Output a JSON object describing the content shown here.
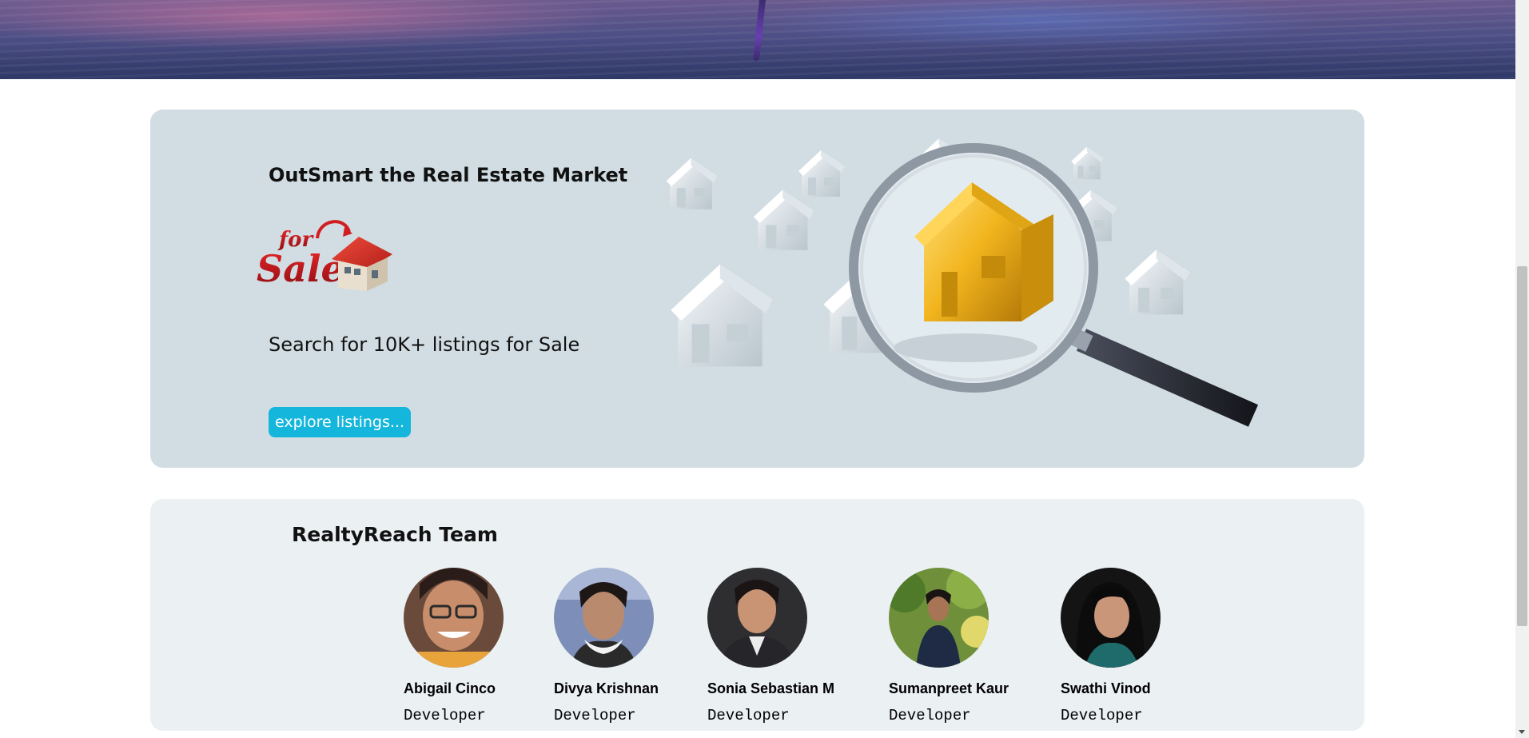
{
  "promo": {
    "title": "OutSmart the Real Estate Market",
    "subtitle": "Search for 10K+ listings for Sale",
    "cta_label": "explore listings...",
    "logo_text_top": "for",
    "logo_text_bottom": "Sale"
  },
  "team": {
    "title": "RealtyReach Team",
    "members": [
      {
        "name": "Abigail Cinco",
        "role": "Developer"
      },
      {
        "name": "Divya Krishnan",
        "role": "Developer"
      },
      {
        "name": "Sonia Sebastian M",
        "role": "Developer"
      },
      {
        "name": "Sumanpreet Kaur",
        "role": "Developer"
      },
      {
        "name": "Swathi Vinod",
        "role": "Developer"
      }
    ]
  },
  "colors": {
    "accent": "#14b6dc",
    "promo_bg": "#d1dde2",
    "team_bg": "#ebf0f3"
  }
}
